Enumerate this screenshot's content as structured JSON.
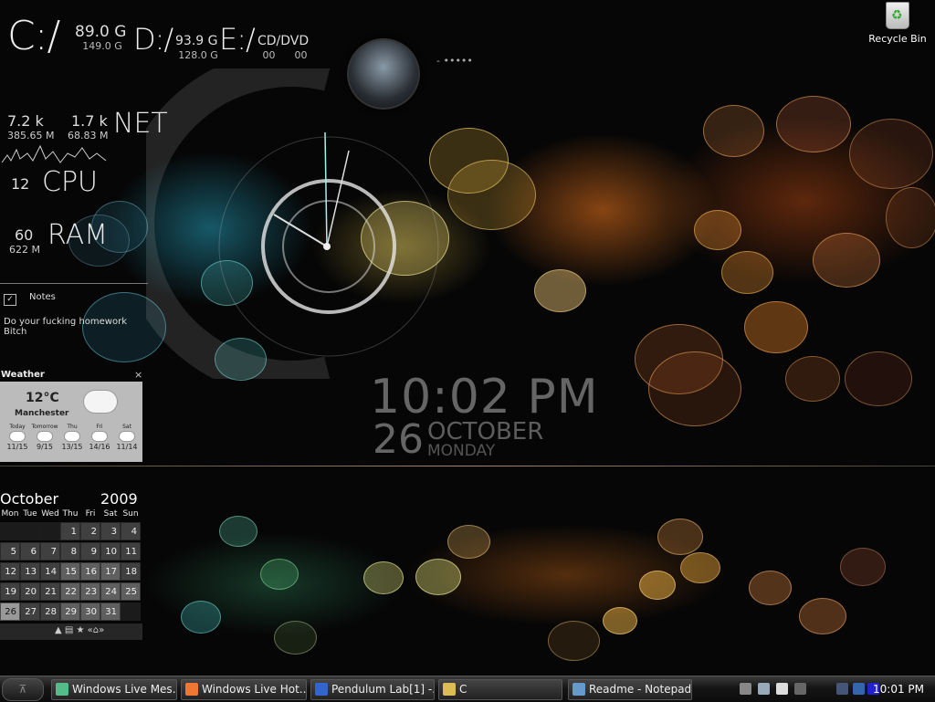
{
  "drives": [
    {
      "letter": "C:/",
      "free": "89.0 G",
      "total": "149.0 G"
    },
    {
      "letter": "D:/",
      "free": "93.9 G",
      "total": "128.0 G"
    },
    {
      "letter": "E:/",
      "free": "CD/DVD",
      "total": "00      00"
    }
  ],
  "net": {
    "label": "NET",
    "up": "7.2 k",
    "up_total": "385.65 M",
    "down": "1.7 k",
    "down_total": "68.83 M"
  },
  "cpu": {
    "label": "CPU",
    "value": "12"
  },
  "ram": {
    "label": "RAM",
    "value": "60",
    "used": "622 M"
  },
  "notes": {
    "title": "Notes",
    "text_line1": "Do your fucking homework",
    "text_line2": "Bitch"
  },
  "weather": {
    "title": "Weather",
    "close": "×",
    "temp": "12°C",
    "city": "Manchester",
    "days": [
      {
        "name": "Today",
        "range": "11/15"
      },
      {
        "name": "Tomorrow",
        "range": "9/15"
      },
      {
        "name": "Thu",
        "range": "13/15"
      },
      {
        "name": "Fri",
        "range": "14/16"
      },
      {
        "name": "Sat",
        "range": "11/14"
      }
    ]
  },
  "clock": {
    "time": "10:02 PM",
    "day": "26",
    "month": "OCTOBER",
    "weekday": "MONDAY"
  },
  "dock_dots": "- •••••",
  "recycle_bin": "Recycle Bin",
  "calendar": {
    "month": "October",
    "year": "2009",
    "weekdays": [
      "Mon",
      "Tue",
      "Wed",
      "Thu",
      "Fri",
      "Sat",
      "Sun"
    ],
    "weeks": [
      [
        "",
        "",
        "",
        "1",
        "2",
        "3",
        "4"
      ],
      [
        "5",
        "6",
        "7",
        "8",
        "9",
        "10",
        "11"
      ],
      [
        "12",
        "13",
        "14",
        "15",
        "16",
        "17",
        "18"
      ],
      [
        "19",
        "20",
        "21",
        "22",
        "23",
        "24",
        "25"
      ],
      [
        "26",
        "27",
        "28",
        "29",
        "30",
        "31",
        ""
      ]
    ],
    "footer": "▲ ▤ ★ «⌂»"
  },
  "taskbar": {
    "tasks": [
      {
        "label": "Windows Live Mes...",
        "color": "#5b8"
      },
      {
        "label": "Windows Live Hot...",
        "color": "#e73"
      },
      {
        "label": "Pendulum Lab[1] -...",
        "color": "#36c"
      },
      {
        "label": "C",
        "color": "#db5"
      },
      {
        "label": "Readme - Notepad",
        "color": "#69c"
      }
    ],
    "clock": "10:01 PM"
  }
}
